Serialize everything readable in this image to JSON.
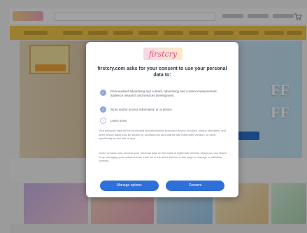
{
  "app": {
    "logo_text": "firstcry"
  },
  "hero": {
    "off_text_1": "FF",
    "off_text_2": "FF"
  },
  "consent": {
    "title": "firstcry.com asks for your consent to use your personal data to:",
    "options": [
      {
        "icon": "checked-circle-icon",
        "text": "Personalised advertising and content, advertising and content measurement, audience research and services development"
      },
      {
        "icon": "checked-circle-icon",
        "text": "Store and/or access information on a device"
      },
      {
        "icon": "expand-circle-icon",
        "text": "Learn more"
      }
    ],
    "legal_1": "Your personal data will be processed and information from your device (cookies, unique identifiers, and other device data) may be stored by, accessed by and shared with third party vendors, or used specifically by this site or app.",
    "legal_2": "Some vendors may process your personal data on the basis of legitimate interest, which you can object to by managing your options below. Look for a link at the bottom of this page to manage or withdraw consent.",
    "manage_label": "Manage options",
    "consent_label": "Consent"
  },
  "colors": {
    "accent": "#2f6fd8",
    "nav_yellow": "#f2c94c",
    "overlay": "rgba(0,0,0,0.36)"
  }
}
